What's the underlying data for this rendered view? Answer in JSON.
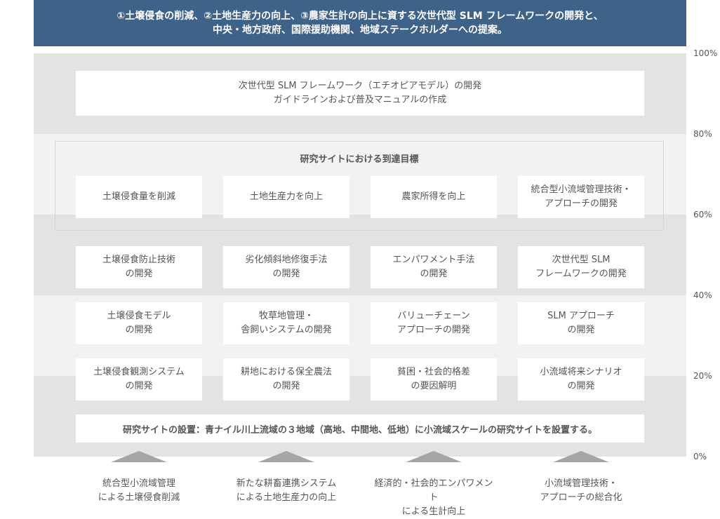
{
  "header": {
    "line1": "①土壌侵食の削減、②土地生産力の向上、③農家生計の向上に資する次世代型 SLM フレームワークの開発と、",
    "line2": "中央・地方政府、国際援助機関、地域ステークホルダーへの提案。"
  },
  "axis": {
    "ticks": [
      "100%",
      "80%",
      "60%",
      "40%",
      "20%",
      "0%"
    ]
  },
  "framework_box": {
    "line1": "次世代型 SLM フレームワーク（エチオピアモデル）の開発",
    "line2": "ガイドラインおよび普及マニュアルの作成"
  },
  "goals": {
    "title": "研究サイトにおける到達目標",
    "items": [
      {
        "line1": "土壌侵食量を削減",
        "line2": ""
      },
      {
        "line1": "土地生産力を向上",
        "line2": ""
      },
      {
        "line1": "農家所得を向上",
        "line2": ""
      },
      {
        "line1": "統合型小流域管理技術・",
        "line2": "アプローチの開発"
      }
    ]
  },
  "rows": [
    [
      {
        "line1": "土壌侵食防止技術",
        "line2": "の開発"
      },
      {
        "line1": "劣化傾斜地修復手法",
        "line2": "の開発"
      },
      {
        "line1": "エンパワメント手法",
        "line2": "の開発"
      },
      {
        "line1": "次世代型 SLM",
        "line2": "フレームワークの開発"
      }
    ],
    [
      {
        "line1": "土壌侵食モデル",
        "line2": "の開発"
      },
      {
        "line1": "牧草地管理・",
        "line2": "舎飼いシステムの開発"
      },
      {
        "line1": "バリューチェーン",
        "line2": "アプローチの開発"
      },
      {
        "line1": "SLM アプローチ",
        "line2": "の開発"
      }
    ],
    [
      {
        "line1": "土壌侵食観測システム",
        "line2": "の開発"
      },
      {
        "line1": "耕地における保全農法",
        "line2": "の開発"
      },
      {
        "line1": "貧困・社会的格差",
        "line2": "の要因解明"
      },
      {
        "line1": "小流域将来シナリオ",
        "line2": "の開発"
      }
    ]
  ],
  "site_setup": "研究サイトの設置：青ナイル川上流域の３地域（高地、中間地、低地）に小流域スケールの研究サイトを設置する。",
  "bottom": [
    {
      "line1": "統合型小流域管理",
      "line2": "による土壌侵食削減"
    },
    {
      "line1": "新たな耕畜連携システム",
      "line2": "による土地生産力の向上"
    },
    {
      "line1": "経済的・社会的エンパワメント",
      "line2": "による生計向上"
    },
    {
      "line1": "小流域管理技術・",
      "line2": "アプローチの総合化"
    }
  ],
  "colors": {
    "header_bg": "#3f6289",
    "band_dark": "#e3e3e3",
    "band_light": "#f2f2f2",
    "arrow": "#a5a5a5"
  }
}
